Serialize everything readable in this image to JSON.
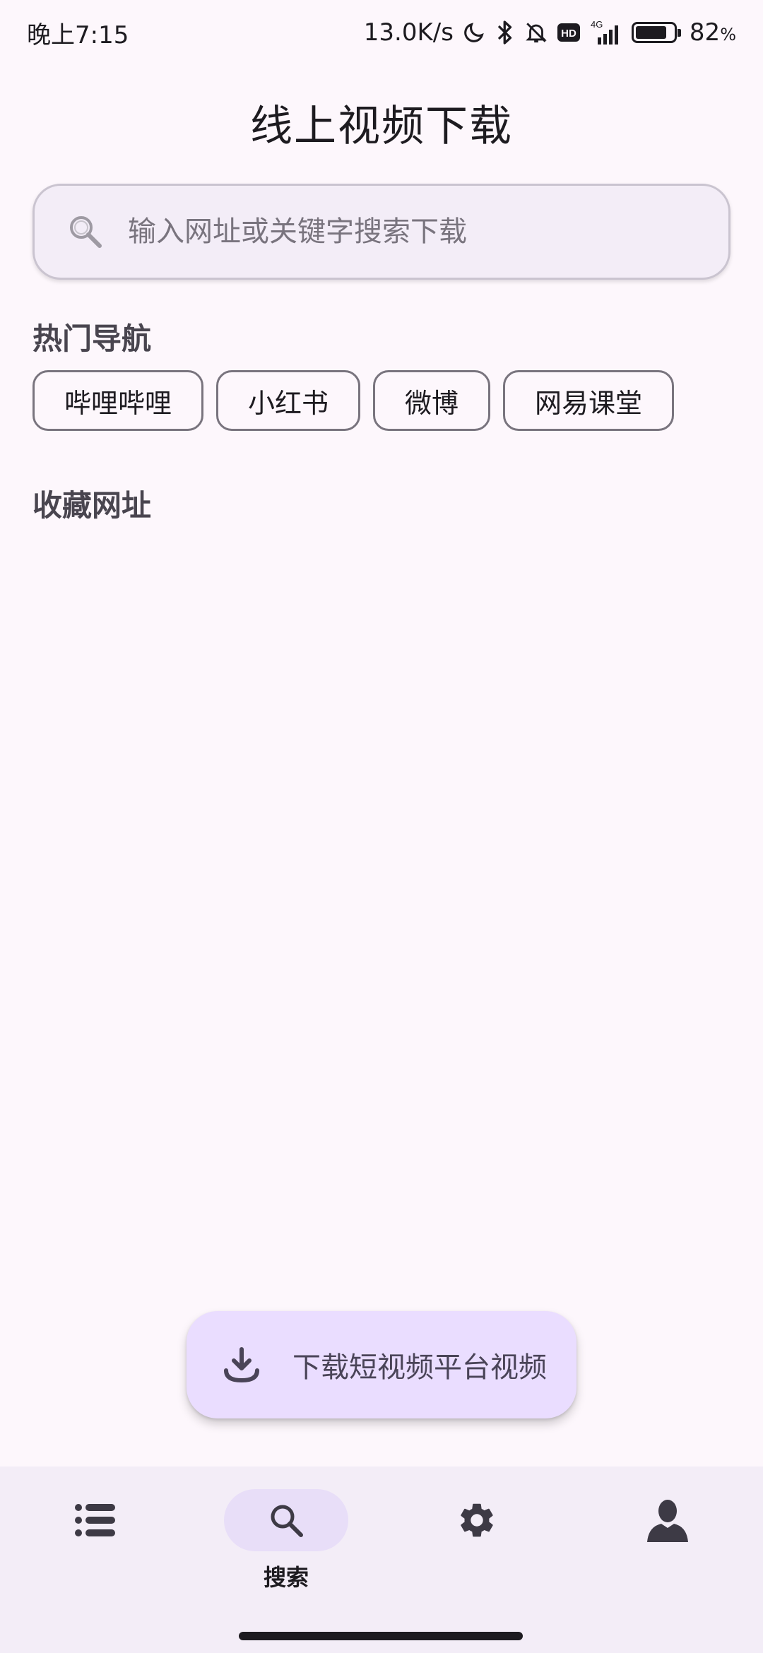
{
  "status_bar": {
    "time": "晚上7:15",
    "net_speed": "13.0K/s",
    "network_type": "4G",
    "hd_badge": "HD",
    "battery_percent": "82",
    "battery_unit": "%",
    "battery_level": 0.82
  },
  "page_title": "线上视频下载",
  "search": {
    "placeholder": "输入网址或关键字搜索下载",
    "value": ""
  },
  "hot_nav": {
    "title": "热门导航",
    "chips": [
      "哔哩哔哩",
      "小红书",
      "微博",
      "网易课堂"
    ]
  },
  "favorites": {
    "title": "收藏网址"
  },
  "fab": {
    "label": "下载短视频平台视频"
  },
  "bottom_nav": {
    "items": [
      {
        "icon": "list-icon",
        "label": ""
      },
      {
        "icon": "search-icon",
        "label": "搜索"
      },
      {
        "icon": "gear-icon",
        "label": ""
      },
      {
        "icon": "person-icon",
        "label": ""
      }
    ],
    "active_index": 1
  },
  "colors": {
    "background": "#fdf7fc",
    "fab_bg": "#eaddff",
    "nav_bg": "#f3edf7",
    "nav_active": "#e8def8"
  }
}
